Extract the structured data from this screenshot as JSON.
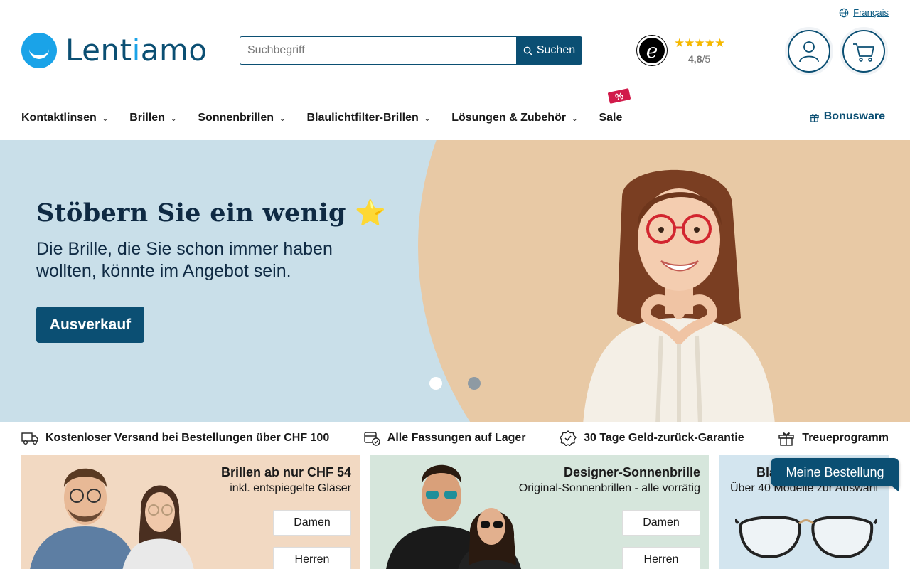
{
  "header": {
    "language_label": "Français",
    "logo_text_part1": "Lent",
    "logo_text_part2": "i",
    "logo_text_part3": "amo",
    "search": {
      "placeholder": "Suchbegriff",
      "button_label": "Suchen"
    },
    "trust": {
      "stars": "★★★★★",
      "score": "4,8",
      "scale": "/5"
    }
  },
  "nav": {
    "items": [
      {
        "label": "Kontaktlinsen"
      },
      {
        "label": "Brillen"
      },
      {
        "label": "Sonnenbrillen"
      },
      {
        "label": "Blaulichtfilter-Brillen"
      },
      {
        "label": "Lösungen & Zubehör"
      },
      {
        "label": "Sale"
      }
    ],
    "sale_badge": "%",
    "bonus_label": "Bonusware"
  },
  "hero": {
    "title": "Stöbern Sie ein wenig",
    "title_emoji": "⭐",
    "subtitle": "Die Brille, die Sie schon immer haben wollten, könnte im Angebot sein.",
    "button_label": "Ausverkauf",
    "slide_count": 2,
    "active_slide": 1
  },
  "usp": [
    {
      "icon": "truck-icon",
      "label": "Kostenloser Versand bei Bestellungen über CHF 100"
    },
    {
      "icon": "box-check-icon",
      "label": "Alle Fassungen auf Lager"
    },
    {
      "icon": "badge-check-icon",
      "label": "30 Tage Geld-zurück-Garantie"
    },
    {
      "icon": "gift-icon",
      "label": "Treueprogramm"
    }
  ],
  "cards": [
    {
      "title": "Brillen ab nur CHF 54",
      "subtitle": "inkl. entspiegelte Gläser",
      "btn1": "Damen",
      "btn2": "Herren"
    },
    {
      "title": "Designer-Sonnenbrille",
      "subtitle": "Original-Sonnenbrillen - alle vorrätig",
      "btn1": "Damen",
      "btn2": "Herren"
    },
    {
      "title": "Bla",
      "subtitle": "Über 40 Modelle zur Auswahl"
    }
  ],
  "floating_button": "Meine Bestellung",
  "colors": {
    "brand_dark": "#0b4f73",
    "brand_light": "#1aa3e8",
    "sale_red": "#d11a4a",
    "star": "#f5b800"
  }
}
